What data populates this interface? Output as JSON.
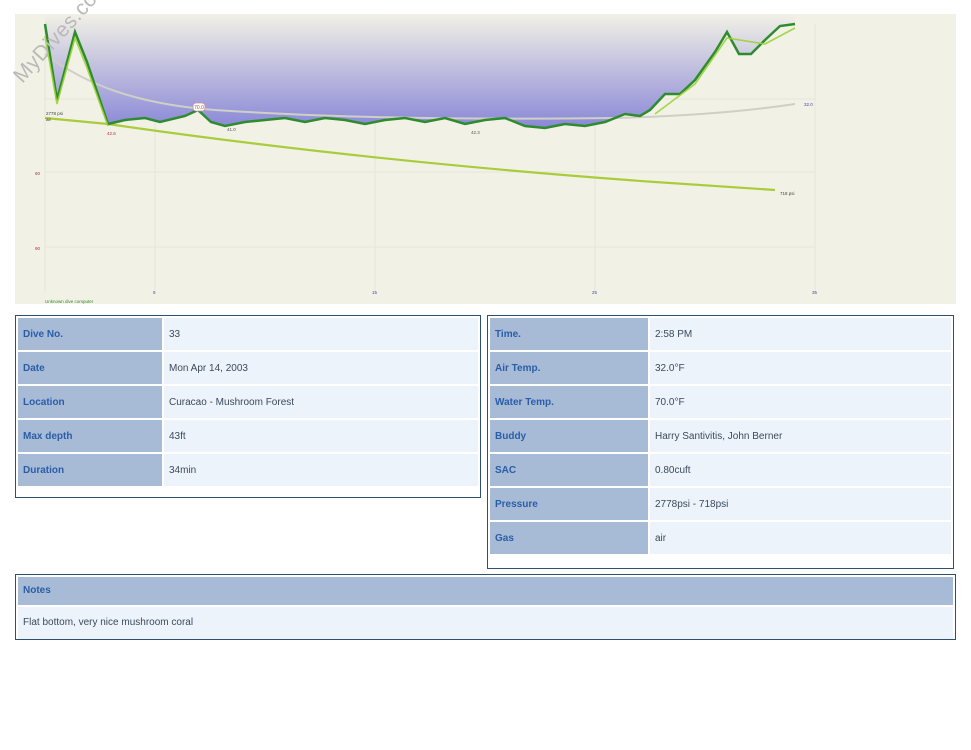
{
  "watermark": "MyDives.com",
  "profile": {
    "start_pressure_label": "2778 psi",
    "gas_label": "air",
    "end_pressure_label": "718 psi",
    "right_value_label": "32.0",
    "temp_marker": "70.0",
    "depth_ticks": [
      "60",
      "90"
    ],
    "time_ticks": [
      "5",
      "15",
      "25",
      "35"
    ],
    "depth_annotations": [
      "42.6",
      "41.0",
      "42.3"
    ],
    "source_label": "Unknown dive computer",
    "colors": {
      "depth_line": "#2e8b2e",
      "fill": "#8c8ad8",
      "pressure_line": "#8fc640",
      "temperature_line": "#c9c9c0"
    }
  },
  "dive_info": {
    "rows": [
      {
        "label": "Dive No.",
        "value": "33"
      },
      {
        "label": "Date",
        "value": "Mon Apr 14, 2003"
      },
      {
        "label": "Location",
        "value": "Curacao - Mushroom Forest"
      },
      {
        "label": "Max depth",
        "value": "43ft"
      },
      {
        "label": "Duration",
        "value": "34min"
      }
    ]
  },
  "conditions": {
    "rows": [
      {
        "label": "Time.",
        "value": "2:58 PM"
      },
      {
        "label": "Air Temp.",
        "value": "32.0°F"
      },
      {
        "label": "Water Temp.",
        "value": "70.0°F"
      },
      {
        "label": "Buddy",
        "value": "Harry Santivitis, John Berner"
      },
      {
        "label": "SAC",
        "value": "0.80cuft"
      },
      {
        "label": "Pressure",
        "value": "2778psi - 718psi"
      },
      {
        "label": "Gas",
        "value": "air"
      }
    ]
  },
  "notes": {
    "title": "Notes",
    "text": "Flat bottom, very nice mushroom coral"
  }
}
